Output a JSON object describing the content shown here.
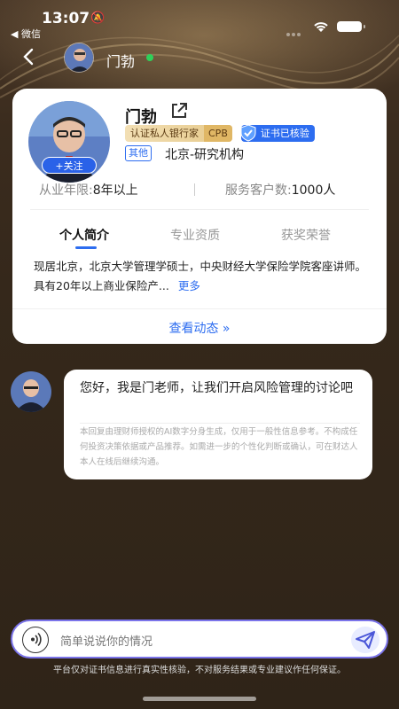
{
  "status_bar": {
    "time": "13:07",
    "back_app": "◀ 微信"
  },
  "nav": {
    "name": "门勃",
    "online_color": "#2fd05a"
  },
  "profile": {
    "name": "门勃",
    "badge_label": "认证私人银行家",
    "badge_cpb": "CPB",
    "verified_label": "证书已核验",
    "tag": "其他",
    "org": "北京-研究机构",
    "follow_label": "+关注",
    "years_label": "从业年限:",
    "years_value": "8年以上",
    "clients_label": "服务客户数:",
    "clients_value": "1000人",
    "tabs": [
      "个人简介",
      "专业资质",
      "获奖荣誉"
    ],
    "active_tab": "个人简介",
    "bio": "现居北京，北京大学管理学硕士，中央财经大学保险学院客座讲师。具有20年以上商业保险产...",
    "more_label": "更多",
    "view_activity": "查看动态 »"
  },
  "chat": {
    "message": "您好，我是门老师，让我们开启风险管理的讨论吧",
    "disclaimer": "本回复由理财师授权的AI数字分身生成，仅用于一般性信息参考。不构成任何投资决策依据或产品推荐。如需进一步的个性化判断或确认，可在财达人本人在线后继续沟通。"
  },
  "input": {
    "placeholder": "简单说说你的情况"
  },
  "footer_note": "平台仅对证书信息进行真实性核验，不对服务结果或专业建议作任何保证。",
  "colors": {
    "accent": "#2d6df0",
    "input_border": "#7b74ea"
  }
}
